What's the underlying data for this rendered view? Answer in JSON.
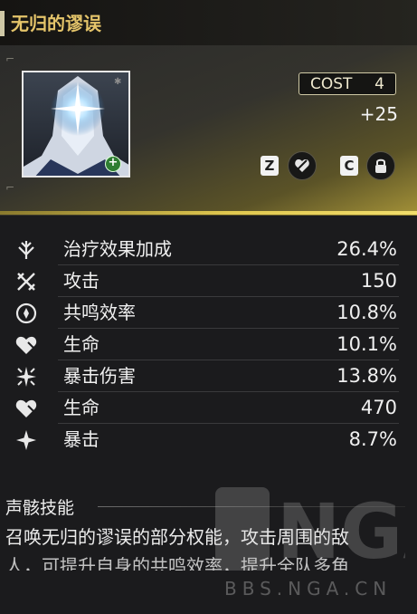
{
  "header": {
    "title": "无归的谬误"
  },
  "card": {
    "cost_label": "COST",
    "cost_value": "4",
    "level": "+25",
    "keys": {
      "z": "Z",
      "c": "C"
    }
  },
  "colors": {
    "accent": "#e4c46a",
    "gold_bar": "#e0c74f",
    "plus_badge": "#2e7d32"
  },
  "stats": [
    {
      "icon": "healing-bonus-icon",
      "name": "治疗效果加成",
      "value": "26.4%"
    },
    {
      "icon": "attack-icon",
      "name": "攻击",
      "value": "150"
    },
    {
      "icon": "energy-regen-icon",
      "name": "共鸣效率",
      "value": "10.8%"
    },
    {
      "icon": "hp-icon",
      "name": "生命",
      "value": "10.1%"
    },
    {
      "icon": "crit-damage-icon",
      "name": "暴击伤害",
      "value": "13.8%"
    },
    {
      "icon": "hp-icon",
      "name": "生命",
      "value": "470"
    },
    {
      "icon": "crit-rate-icon",
      "name": "暴击",
      "value": "8.7%"
    }
  ],
  "skill": {
    "title": "声骸技能",
    "line1": "召唤无归的谬误的部分权能，攻击周围的敌",
    "line2": "人，可提升自身的共鸣效率，提升全队多角"
  },
  "watermark": {
    "text": "BBS.NGA.CN",
    "logo": "NGA"
  }
}
